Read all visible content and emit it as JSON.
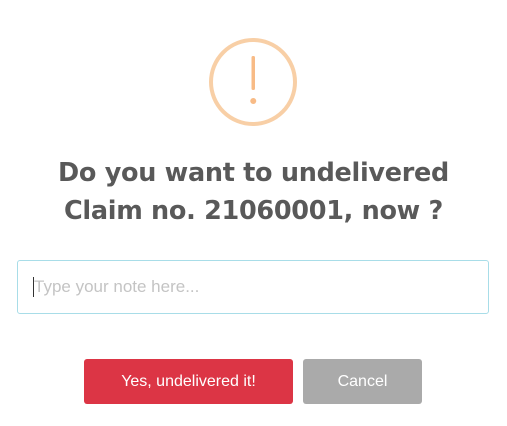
{
  "dialog": {
    "icon": "exclamation-icon",
    "icon_color": "#f8bb86",
    "title_line1": "Do you want to undelivered",
    "title_line2": "Claim no. 21060001, now ?",
    "note_input": {
      "placeholder": "Type your note here...",
      "value": ""
    },
    "confirm_label": "Yes, undelivered it!",
    "cancel_label": "Cancel",
    "confirm_color": "#dc3545",
    "cancel_color": "#aaaaaa"
  }
}
